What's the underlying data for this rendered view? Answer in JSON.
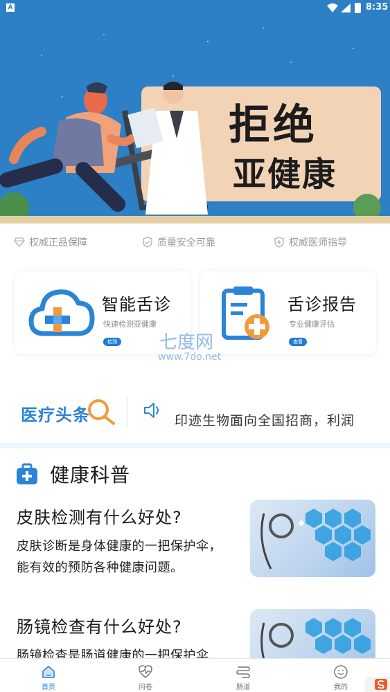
{
  "status_bar": {
    "time": "8:35",
    "app_icon_letter": "A"
  },
  "banner": {
    "title_line1": "拒绝",
    "title_line2": "亚健康"
  },
  "guarantees": [
    {
      "label": "权威正品保障",
      "icon": "diamond-icon"
    },
    {
      "label": "质量安全可靠",
      "icon": "shield-check-icon"
    },
    {
      "label": "权威医师指导",
      "icon": "shield-plus-icon"
    }
  ],
  "features": [
    {
      "title": "智能舌诊",
      "subtitle": "快速检测亚健康",
      "badge": "检测",
      "icon": "cloud-plus-icon"
    },
    {
      "title": "舌诊报告",
      "subtitle": "专业健康评估",
      "badge": "查看",
      "icon": "clipboard-plus-icon"
    }
  ],
  "watermark": {
    "line1": "七度网",
    "line2": "www.7do.net"
  },
  "ticker": {
    "logo_text": "医疗头条",
    "text": "印迹生物面向全国招商，利润"
  },
  "section": {
    "title": "健康科普"
  },
  "articles": [
    {
      "title": "皮肤检测有什么好处?",
      "desc": "皮肤诊断是身体健康的一把保护伞，能有效的预防各种健康问题。"
    },
    {
      "title": "肠镜检查有什么好处?",
      "desc": "肠镜检查是肠道健康的一把保护伞,"
    }
  ],
  "bottom_nav": [
    {
      "label": "首页",
      "icon": "home-icon",
      "active": true
    },
    {
      "label": "问卷",
      "icon": "heartbeat-icon",
      "active": false
    },
    {
      "label": "肠道",
      "icon": "intestine-icon",
      "active": false
    },
    {
      "label": "我的",
      "icon": "smiley-icon",
      "active": false
    }
  ],
  "colors": {
    "primary": "#2a84d8",
    "banner_bg": "#2d7fc6",
    "accent_orange": "#f29a3a"
  }
}
